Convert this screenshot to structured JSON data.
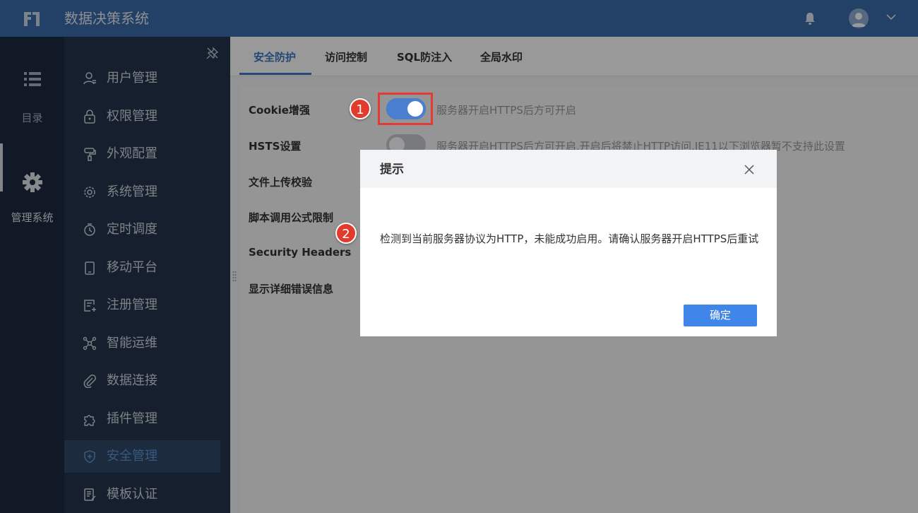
{
  "app": {
    "title": "数据决策系统"
  },
  "rail": {
    "items": [
      {
        "label": "目录",
        "icon": "list-icon"
      },
      {
        "label": "管理系统",
        "icon": "gear-icon"
      }
    ]
  },
  "menu": {
    "items": [
      {
        "label": "用户管理",
        "icon": "user-icon"
      },
      {
        "label": "权限管理",
        "icon": "lock-icon"
      },
      {
        "label": "外观配置",
        "icon": "paint-roller-icon"
      },
      {
        "label": "系统管理",
        "icon": "settings-gear-icon"
      },
      {
        "label": "定时调度",
        "icon": "timer-icon"
      },
      {
        "label": "移动平台",
        "icon": "tablet-icon"
      },
      {
        "label": "注册管理",
        "icon": "register-icon"
      },
      {
        "label": "智能运维",
        "icon": "network-icon"
      },
      {
        "label": "数据连接",
        "icon": "paperclip-icon"
      },
      {
        "label": "插件管理",
        "icon": "puzzle-icon"
      },
      {
        "label": "安全管理",
        "icon": "shield-icon"
      },
      {
        "label": "模板认证",
        "icon": "template-icon"
      }
    ],
    "active_index": 10
  },
  "tabs": [
    {
      "label": "安全防护",
      "active": true
    },
    {
      "label": "访问控制",
      "active": false
    },
    {
      "label": "SQL防注入",
      "active": false
    },
    {
      "label": "全局水印",
      "active": false
    }
  ],
  "settings": [
    {
      "label": "Cookie增强",
      "hint": "服务器开启HTTPS后方可开启",
      "toggle": "on"
    },
    {
      "label": "HSTS设置",
      "hint": "服务器开启HTTPS后方可开启,开启后将禁止HTTP访问,IE11以下浏览器暂不支持此设置",
      "toggle": "off"
    },
    {
      "label": "文件上传校验"
    },
    {
      "label": "脚本调用公式限制"
    },
    {
      "label": "Security Headers"
    },
    {
      "label": "显示详细错误信息"
    }
  ],
  "badges": {
    "step1": "1",
    "step2": "2"
  },
  "dialog": {
    "title": "提示",
    "message": "检测到当前服务器协议为HTTP，未能成功启用。请确认服务器开启HTTPS后重试",
    "ok_label": "确定"
  },
  "colors": {
    "topbar": "#3b6cab",
    "accent": "#3d78c9",
    "badge": "#e23b2e",
    "highlight": "#e53935"
  }
}
